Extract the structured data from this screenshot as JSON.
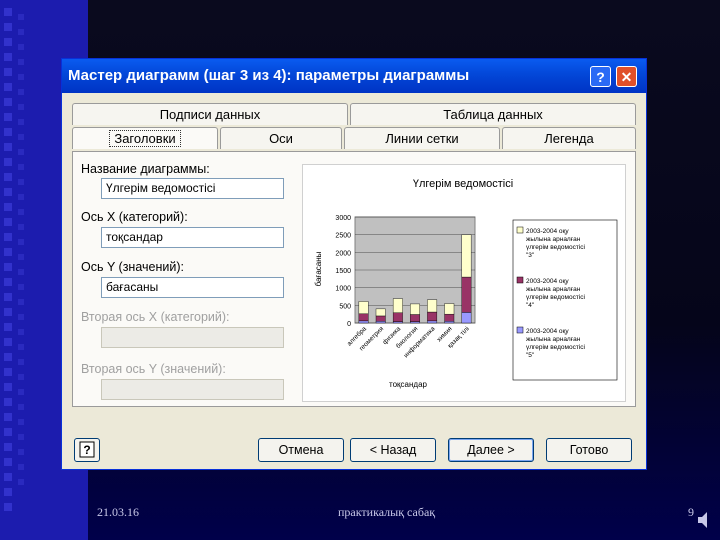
{
  "dialog": {
    "title": "Мастер диаграмм (шаг 3 из 4): параметры диаграммы",
    "help_label": "?",
    "close_label": "✕"
  },
  "tabs": {
    "row1": [
      "Подписи данных",
      "Таблица данных"
    ],
    "row2": [
      "Заголовки",
      "Оси",
      "Линии сетки",
      "Легенда"
    ],
    "active": "Заголовки"
  },
  "form": {
    "chart_title_label": "Название диаграммы:",
    "chart_title_value": "Үлгерім ведомостісі",
    "x_axis_label": "Ось X (категорий):",
    "x_axis_value": "тоқсандар",
    "y_axis_label": "Ось Y (значений):",
    "y_axis_value": "бағасаны",
    "x2_axis_label": "Вторая ось X (категорий):",
    "y2_axis_label": "Вторая ось Y (значений):"
  },
  "buttons": {
    "cancel": "Отмена",
    "back": "< Назад",
    "next": "Далее >",
    "finish": "Готово",
    "help": "?"
  },
  "footer": {
    "date": "21.03.16",
    "caption": "практикалық сабақ",
    "page": "9"
  },
  "colors": {
    "series_3": "#ffffcc",
    "series_4": "#993366",
    "series_5": "#9999ff"
  },
  "chart_data": {
    "type": "bar",
    "stacked": true,
    "title": "Үлгерім ведомостісі",
    "xlabel": "тоқсандар",
    "ylabel": "бағасаны",
    "ylim": [
      0,
      3000
    ],
    "yticks": [
      "3000",
      "2500",
      "2000",
      "1500",
      "1000",
      "500",
      "0"
    ],
    "categories": [
      "алгебра",
      "геометрия",
      "физика",
      "биология",
      "информатика",
      "химия",
      "қазақ тілі"
    ],
    "legend_position": "right",
    "series": [
      {
        "name": "2003-2004 оқу жылына арналған үлгерім ведомостісі \"5\"",
        "values": [
          60,
          50,
          40,
          40,
          60,
          50,
          300
        ]
      },
      {
        "name": "2003-2004 оқу жылына арналған үлгерім ведомостісі \"4\"",
        "values": [
          200,
          150,
          250,
          200,
          250,
          200,
          1000
        ]
      },
      {
        "name": "2003-2004 оқу жылына арналған үлгерім ведомостісі \"3\"",
        "values": [
          350,
          200,
          400,
          300,
          350,
          300,
          1200
        ]
      }
    ]
  }
}
